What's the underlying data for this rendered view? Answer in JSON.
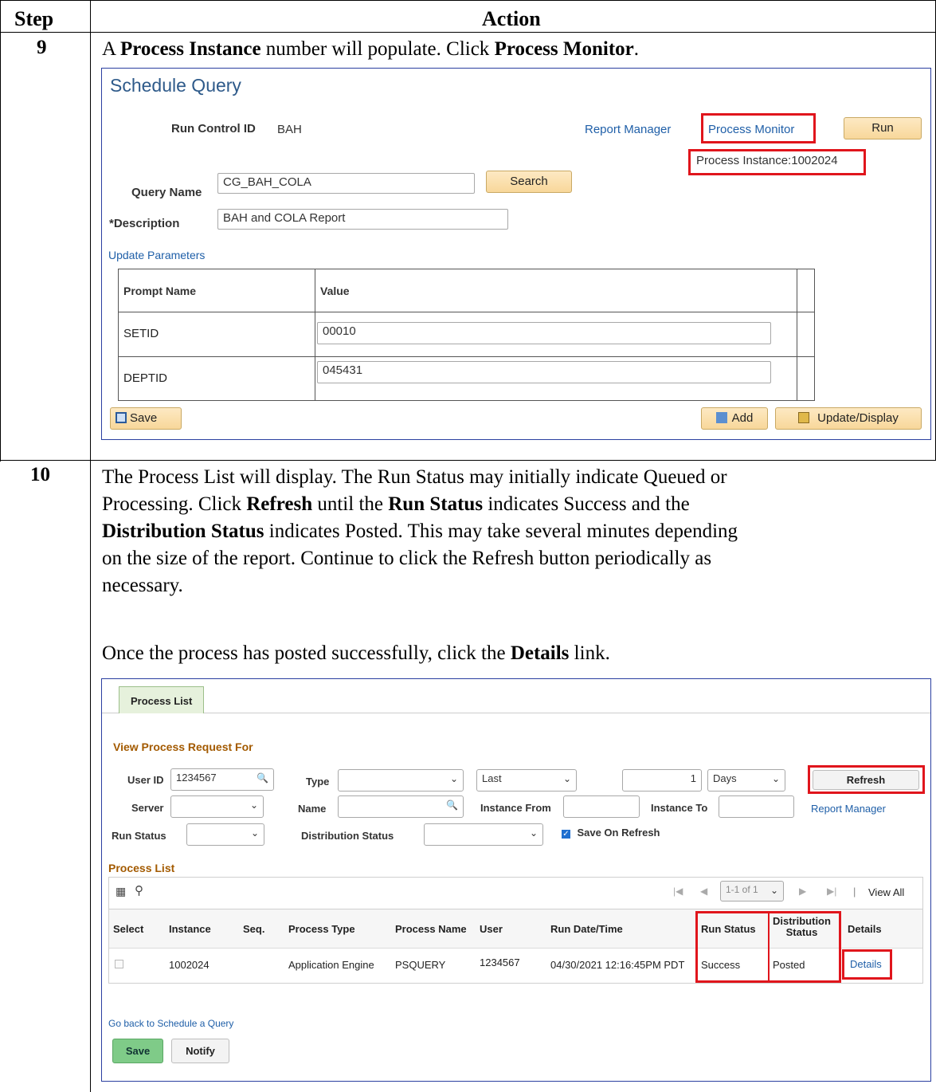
{
  "table": {
    "header_step": "Step",
    "header_action": "Action"
  },
  "step9": {
    "number": "9",
    "instruction": {
      "t1": "A ",
      "b1": "Process Instance",
      "t2": " number will populate.  Click ",
      "b2": "Process Monitor",
      "t3": "."
    },
    "screen": {
      "title": "Schedule Query",
      "run_control_label": "Run Control ID",
      "run_control_value": "BAH",
      "report_manager": "Report Manager",
      "process_monitor": "Process Monitor",
      "run_button": "Run",
      "process_instance": "Process Instance:1002024",
      "query_name_label": "Query Name",
      "query_name_value": "CG_BAH_COLA",
      "search_button": "Search",
      "description_label": "*Description",
      "description_value": "BAH and COLA Report",
      "update_parameters": "Update Parameters",
      "grid": {
        "col_prompt": "Prompt Name",
        "col_value": "Value",
        "rows": [
          {
            "prompt": "SETID",
            "value": "00010"
          },
          {
            "prompt": "DEPTID",
            "value": "045431"
          }
        ]
      },
      "save_button": "Save",
      "add_button": "Add",
      "update_display_button": "Update/Display"
    }
  },
  "step10": {
    "number": "10",
    "para1": {
      "l1": "The Process List will display.  The Run Status may initially indicate Queued or",
      "l2a": "Processing.  Click ",
      "l2b": "Refresh",
      "l2c": " until the ",
      "l2d": "Run Status",
      "l2e": " indicates Success and the",
      "l3a": "Distribution Status",
      "l3b": " indicates Posted.  This may take several minutes depending",
      "l4": "on the size of the report.  Continue to click the Refresh button periodically as",
      "l5": "necessary."
    },
    "para2": {
      "a": "Once the process has posted successfully, click the ",
      "b": "Details",
      "c": " link."
    },
    "screen": {
      "tab": "Process List",
      "view_for": "View Process Request For",
      "user_id_label": "User ID",
      "user_id_value": "1234567",
      "type_label": "Type",
      "last_value": "Last",
      "days_num": "1",
      "days_value": "Days",
      "refresh_button": "Refresh",
      "server_label": "Server",
      "name_label": "Name",
      "instance_from_label": "Instance From",
      "instance_to_label": "Instance To",
      "report_manager": "Report Manager",
      "run_status_label": "Run Status",
      "dist_status_label": "Distribution Status",
      "save_on_refresh": "Save On Refresh",
      "process_list_heading": "Process List",
      "pagination": "1-1 of 1",
      "view_all": "View All",
      "columns": {
        "select": "Select",
        "instance": "Instance",
        "seq": "Seq.",
        "process_type": "Process Type",
        "process_name": "Process Name",
        "user": "User",
        "run_datetime": "Run Date/Time",
        "run_status": "Run Status",
        "dist_status_1": "Distribution",
        "dist_status_2": "Status",
        "details": "Details"
      },
      "row": {
        "instance": "1002024",
        "seq": "",
        "process_type": "Application Engine",
        "process_name": "PSQUERY",
        "user": "1234567",
        "run_datetime": "04/30/2021 12:16:45PM PDT",
        "run_status": "Success",
        "dist_status": "Posted",
        "details": "Details"
      },
      "go_back": "Go back to Schedule a Query",
      "save_button": "Save",
      "notify_button": "Notify"
    }
  },
  "colors": {
    "highlight": "#e0151c",
    "link": "#1f5fa8",
    "frame": "#2a3fa0"
  }
}
